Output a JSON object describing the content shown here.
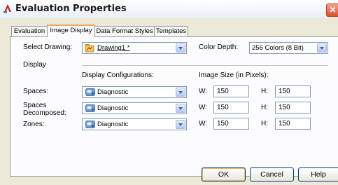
{
  "window": {
    "title": "Evaluation Properties",
    "close_glyph": "✕"
  },
  "tabs": [
    {
      "label": "Evaluation"
    },
    {
      "label": "Image Display",
      "active": true
    },
    {
      "label": "Data Format Styles"
    },
    {
      "label": "Templates"
    }
  ],
  "select_drawing": {
    "label": "Select Drawing:",
    "value": "Drawing1 *"
  },
  "color_depth": {
    "label": "Color Depth:",
    "value": "256 Colors (8 Bit)"
  },
  "display": {
    "heading": "Display",
    "config_header": "Display Configurations:",
    "size_header": "Image Size (in Pixels):",
    "w_label": "W:",
    "h_label": "H:",
    "rows": [
      {
        "label": "Spaces:",
        "config": "Diagnostic",
        "w": "150",
        "h": "150"
      },
      {
        "label_line1": "Spaces",
        "label_line2": "Decomposed:",
        "config": "Diagnostic",
        "w": "150",
        "h": "150"
      },
      {
        "label": "Zones:",
        "config": "Diagnostic",
        "w": "150",
        "h": "150"
      }
    ]
  },
  "buttons": {
    "ok": "OK",
    "cancel": "Cancel",
    "help": "Help"
  },
  "colors": {
    "accent_tab": "#f0a35a",
    "window_bg": "#ece9d8",
    "input_border": "#7f9db9"
  },
  "icons": [
    "autocad-app-icon",
    "drawing-icon",
    "display-config-icon"
  ]
}
